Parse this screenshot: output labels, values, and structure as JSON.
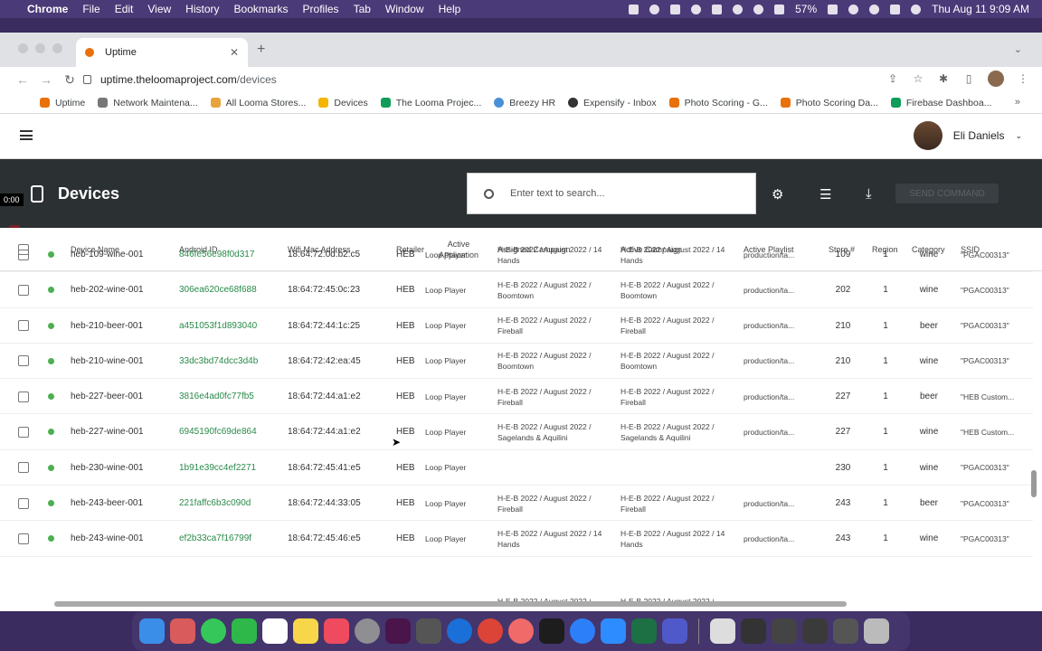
{
  "menubar": {
    "app": "Chrome",
    "items": [
      "File",
      "Edit",
      "View",
      "History",
      "Bookmarks",
      "Profiles",
      "Tab",
      "Window",
      "Help"
    ],
    "battery": "57%",
    "datetime": "Thu Aug 11  9:09 AM"
  },
  "browser": {
    "tab_title": "Uptime",
    "url_host": "uptime.theloomaproject.com",
    "url_path": "/devices",
    "bookmarks": [
      {
        "label": "Uptime",
        "color": "#e8710a"
      },
      {
        "label": "Network Maintena...",
        "color": "#777777"
      },
      {
        "label": "All Looma Stores...",
        "color": "#e8a33c"
      },
      {
        "label": "Devices",
        "color": "#f4b400"
      },
      {
        "label": "The Looma Projec...",
        "color": "#0f9d58"
      },
      {
        "label": "Breezy HR",
        "color": "#4a90d9"
      },
      {
        "label": "Expensify - Inbox",
        "color": "#333333"
      },
      {
        "label": "Photo Scoring - G...",
        "color": "#e8710a"
      },
      {
        "label": "Photo Scoring Da...",
        "color": "#e8710a"
      },
      {
        "label": "Firebase Dashboa...",
        "color": "#0f9d58"
      }
    ]
  },
  "header": {
    "user_name": "Eli Daniels"
  },
  "page": {
    "title": "Devices",
    "search_placeholder": "Enter text to search...",
    "send_command": "SEND COMMAND",
    "recording_time": "0:00"
  },
  "columns": [
    "Device Name",
    "Android ID",
    "Wifi Mac Address",
    "Retailer",
    "Active Application",
    "Assigned Campaign",
    "Active Campaign",
    "Active Playlist",
    "Store #",
    "Region",
    "Category",
    "SSID"
  ],
  "rows": [
    {
      "name": "heb-109-wine-001",
      "aid": "846fe56e98f0d317",
      "mac": "18:64:72:0d:b2:c5",
      "retailer": "HEB",
      "app": "Loop Player",
      "assigned": [
        "H-E-B 2022 / August 2022 / 14",
        "Hands"
      ],
      "active": [
        "H-E-B 2022 / August 2022 / 14",
        "Hands"
      ],
      "playlist": "production/ta...",
      "store": "109",
      "region": "1",
      "category": "wine",
      "ssid": "\"PGAC00313\""
    },
    {
      "name": "heb-202-wine-001",
      "aid": "306ea620ce68f688",
      "mac": "18:64:72:45:0c:23",
      "retailer": "HEB",
      "app": "Loop Player",
      "assigned": [
        "H-E-B 2022 / August 2022 /",
        "Boomtown"
      ],
      "active": [
        "H-E-B 2022 / August 2022 /",
        "Boomtown"
      ],
      "playlist": "production/ta...",
      "store": "202",
      "region": "1",
      "category": "wine",
      "ssid": "\"PGAC00313\""
    },
    {
      "name": "heb-210-beer-001",
      "aid": "a451053f1d893040",
      "mac": "18:64:72:44:1c:25",
      "retailer": "HEB",
      "app": "Loop Player",
      "assigned": [
        "H-E-B 2022 / August 2022 /",
        "Fireball"
      ],
      "active": [
        "H-E-B 2022 / August 2022 /",
        "Fireball"
      ],
      "playlist": "production/ta...",
      "store": "210",
      "region": "1",
      "category": "beer",
      "ssid": "\"PGAC00313\""
    },
    {
      "name": "heb-210-wine-001",
      "aid": "33dc3bd74dcc3d4b",
      "mac": "18:64:72:42:ea:45",
      "retailer": "HEB",
      "app": "Loop Player",
      "assigned": [
        "H-E-B 2022 / August 2022 /",
        "Boomtown"
      ],
      "active": [
        "H-E-B 2022 / August 2022 /",
        "Boomtown"
      ],
      "playlist": "production/ta...",
      "store": "210",
      "region": "1",
      "category": "wine",
      "ssid": "\"PGAC00313\""
    },
    {
      "name": "heb-227-beer-001",
      "aid": "3816e4ad0fc77fb5",
      "mac": "18:64:72:44:a1:e2",
      "retailer": "HEB",
      "app": "Loop Player",
      "assigned": [
        "H-E-B 2022 / August 2022 /",
        "Fireball"
      ],
      "active": [
        "H-E-B 2022 / August 2022 /",
        "Fireball"
      ],
      "playlist": "production/ta...",
      "store": "227",
      "region": "1",
      "category": "beer",
      "ssid": "\"HEB Custom..."
    },
    {
      "name": "heb-227-wine-001",
      "aid": "6945190fc69de864",
      "mac": "18:64:72:44:a1:e2",
      "retailer": "HEB",
      "app": "Loop Player",
      "assigned": [
        "H-E-B 2022 / August 2022 /",
        "Sagelands & Aquilini"
      ],
      "active": [
        "H-E-B 2022 / August 2022 /",
        "Sagelands & Aquilini"
      ],
      "playlist": "production/ta...",
      "store": "227",
      "region": "1",
      "category": "wine",
      "ssid": "\"HEB Custom..."
    },
    {
      "name": "heb-230-wine-001",
      "aid": "1b91e39cc4ef2271",
      "mac": "18:64:72:45:41:e5",
      "retailer": "HEB",
      "app": "Loop Player",
      "assigned": [
        "",
        ""
      ],
      "active": [
        "",
        ""
      ],
      "playlist": "",
      "store": "230",
      "region": "1",
      "category": "wine",
      "ssid": "\"PGAC00313\""
    },
    {
      "name": "heb-243-beer-001",
      "aid": "221faffc6b3c090d",
      "mac": "18:64:72:44:33:05",
      "retailer": "HEB",
      "app": "Loop Player",
      "assigned": [
        "H-E-B 2022 / August 2022 /",
        "Fireball"
      ],
      "active": [
        "H-E-B 2022 / August 2022 /",
        "Fireball"
      ],
      "playlist": "production/ta...",
      "store": "243",
      "region": "1",
      "category": "beer",
      "ssid": "\"PGAC00313\""
    },
    {
      "name": "heb-243-wine-001",
      "aid": "ef2b33ca7f16799f",
      "mac": "18:64:72:45:46:e5",
      "retailer": "HEB",
      "app": "Loop Player",
      "assigned": [
        "H-E-B 2022 / August 2022 / 14",
        "Hands"
      ],
      "active": [
        "H-E-B 2022 / August 2022 / 14",
        "Hands"
      ],
      "playlist": "production/ta...",
      "store": "243",
      "region": "1",
      "category": "wine",
      "ssid": "\"PGAC00313\""
    }
  ],
  "partial_row_text": "H-E-B 2022 / August 2022 /",
  "colors": {
    "status_online": "#4caf50",
    "android_id": "#2a8a4a",
    "header_dark": "#2b3033"
  }
}
